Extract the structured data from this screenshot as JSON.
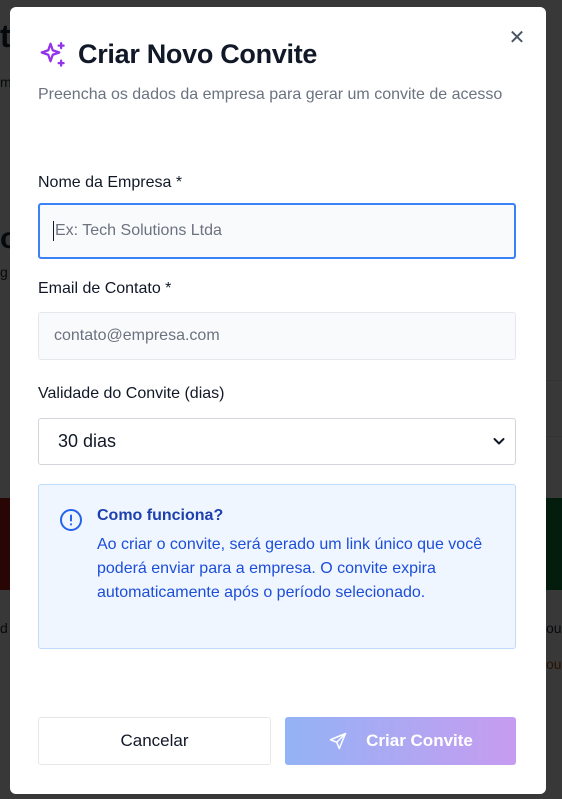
{
  "background": {
    "fragments": [
      "t",
      "m",
      "o",
      "g",
      "d",
      "ou",
      "ou"
    ]
  },
  "modal": {
    "title": "Criar Novo Convite",
    "title_icon": "sparkles-icon",
    "close_icon": "close-icon",
    "subtitle": "Preencha os dados da empresa para gerar um convite de acesso",
    "fields": {
      "company_name": {
        "label": "Nome da Empresa *",
        "placeholder": "Ex: Tech Solutions Ltda",
        "value": ""
      },
      "contact_email": {
        "label": "Email de Contato *",
        "placeholder": "contato@empresa.com",
        "value": ""
      },
      "validity": {
        "label": "Validade do Convite (dias)",
        "selected": "30 dias"
      }
    },
    "info": {
      "icon": "info-circle-icon",
      "title": "Como funciona?",
      "body": "Ao criar o convite, será gerado um link único que você poderá enviar para a empresa. O convite expira automaticamente após o período selecionado."
    },
    "buttons": {
      "cancel": "Cancelar",
      "create": "Criar Convite",
      "create_icon": "send-icon"
    }
  },
  "colors": {
    "accent_purple": "#9333ea",
    "focus_blue": "#3b82f6",
    "info_text": "#1d4ed8",
    "gradient_start": "#93b3f5",
    "gradient_end": "#c79cf0"
  }
}
